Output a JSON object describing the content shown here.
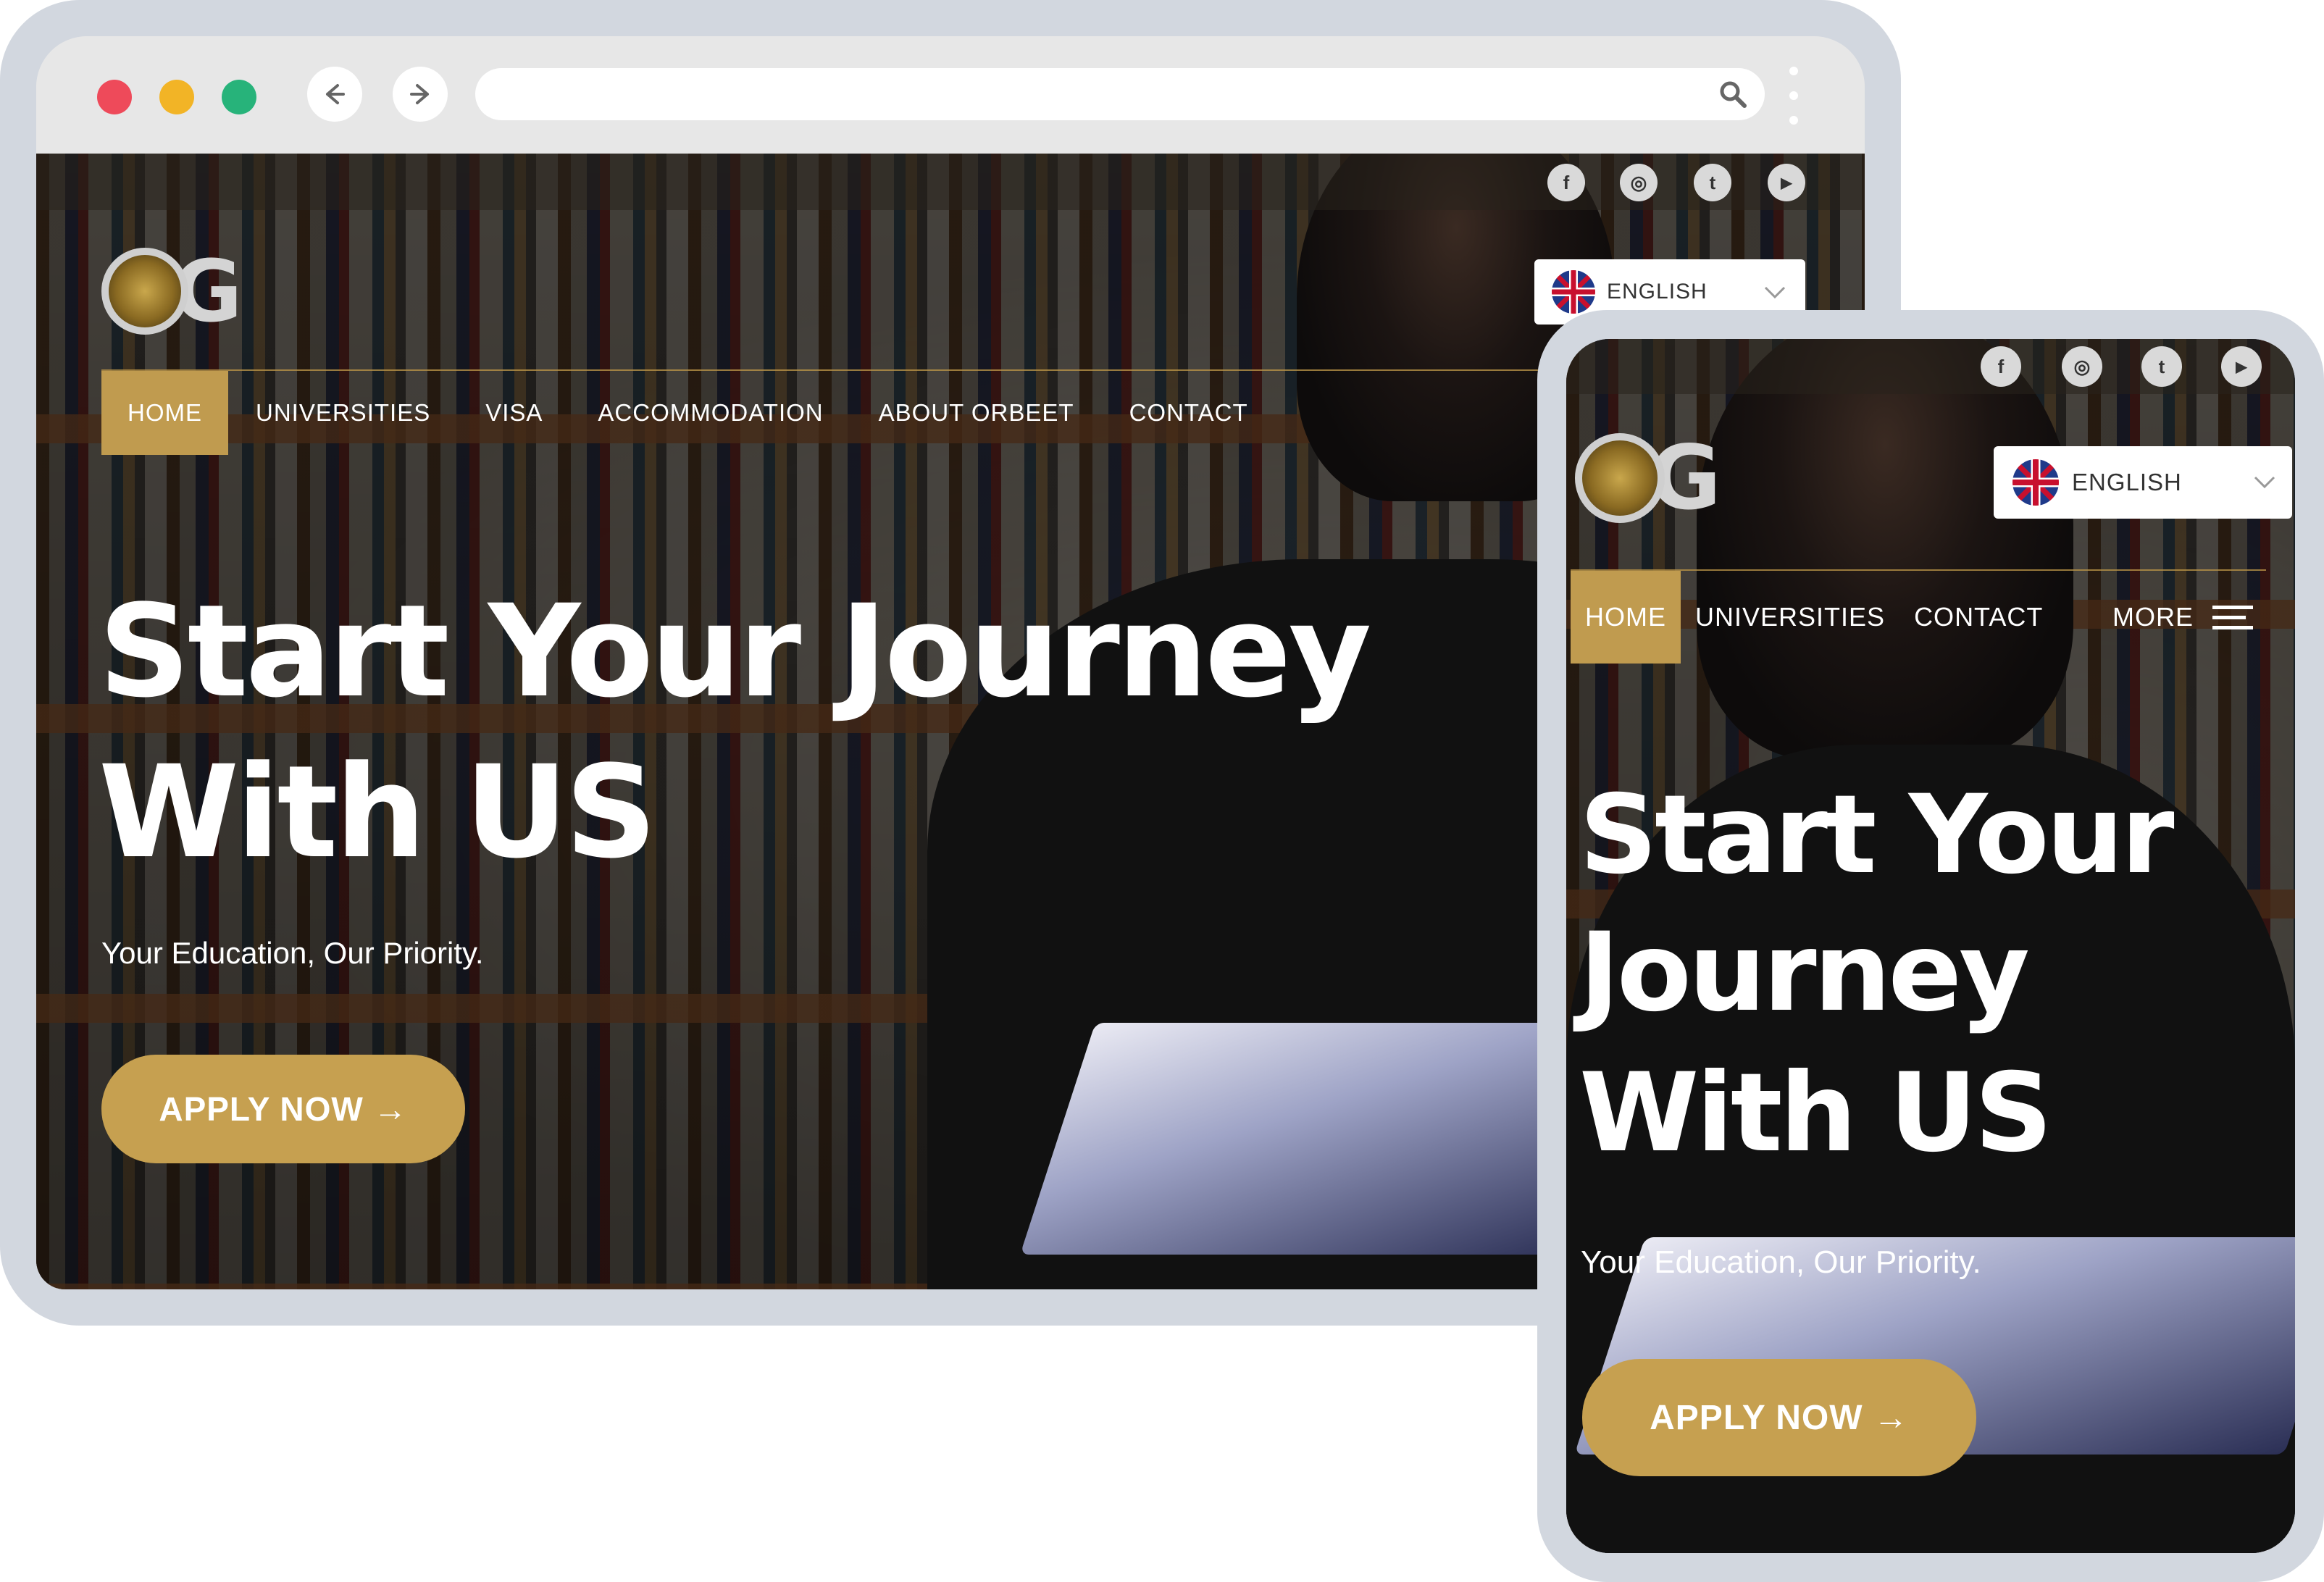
{
  "desktop": {
    "nav": [
      "HOME",
      "UNIVERSITIES",
      "VISA",
      "ACCOMMODATION",
      "ABOUT ORBEET",
      "CONTACT"
    ],
    "language": "ENGLISH",
    "hero_line1": "Start Your Journey",
    "hero_line2": "With US",
    "subtitle": "Your Education, Our Priority.",
    "apply": "APPLY NOW →"
  },
  "mobile": {
    "nav": [
      "HOME",
      "UNIVERSITIES",
      "CONTACT"
    ],
    "more": "MORE",
    "language": "ENGLISH",
    "hero_line1": "Start Your",
    "hero_line2": "Journey",
    "hero_line3": "With US",
    "subtitle": "Your Education, Our Priority.",
    "apply": "APPLY NOW →"
  },
  "social": {
    "facebook": "f",
    "instagram": "◎",
    "twitter": "t",
    "youtube": "▶"
  },
  "colors": {
    "gold": "#c09b4f",
    "frame": "#d2d7df",
    "red_dot": "#ee4a5a",
    "yellow_dot": "#f2b426",
    "green_dot": "#27b37a"
  }
}
